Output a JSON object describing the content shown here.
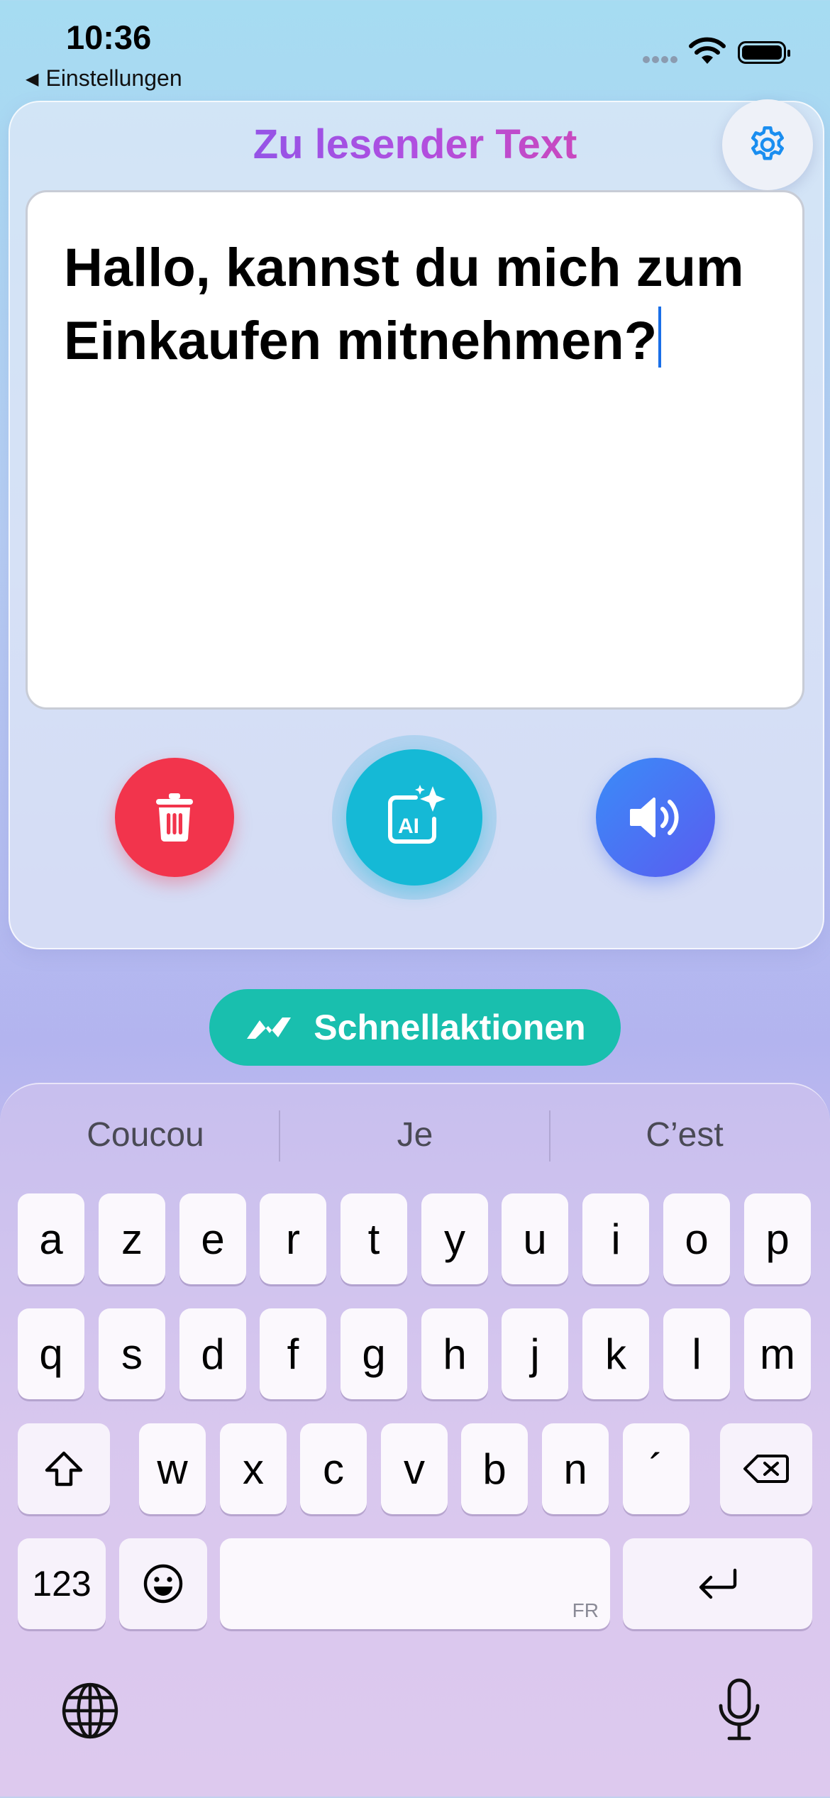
{
  "status_bar": {
    "time": "10:36",
    "back_label": "Einstellungen"
  },
  "header": {
    "title": "Zu lesender Text",
    "settings_icon": "gear-icon"
  },
  "editor": {
    "text": "Hallo, kannst du mich zum Einkaufen mitnehmen?"
  },
  "actions": {
    "delete_icon": "trash-icon",
    "ai_icon": "ai-sparkle-icon",
    "speak_icon": "speaker-icon"
  },
  "quick_actions": {
    "label": "Schnellaktionen",
    "icon": "bolt-icon"
  },
  "keyboard": {
    "suggestions": [
      "Coucou",
      "Je",
      "C’est"
    ],
    "rows": [
      [
        "a",
        "z",
        "e",
        "r",
        "t",
        "y",
        "u",
        "i",
        "o",
        "p"
      ],
      [
        "q",
        "s",
        "d",
        "f",
        "g",
        "h",
        "j",
        "k",
        "l",
        "m"
      ],
      [
        "w",
        "x",
        "c",
        "v",
        "b",
        "n",
        "´"
      ]
    ],
    "numbers_label": "123",
    "space_language": "FR"
  },
  "colors": {
    "title_gradient": [
      "#6a5cf0",
      "#ee3e8a"
    ],
    "delete": "#f2344c",
    "ai": "#15b9d6",
    "speak": "#4a74f4",
    "quick_actions": "#19bfae",
    "caret": "#1a6fe8"
  }
}
